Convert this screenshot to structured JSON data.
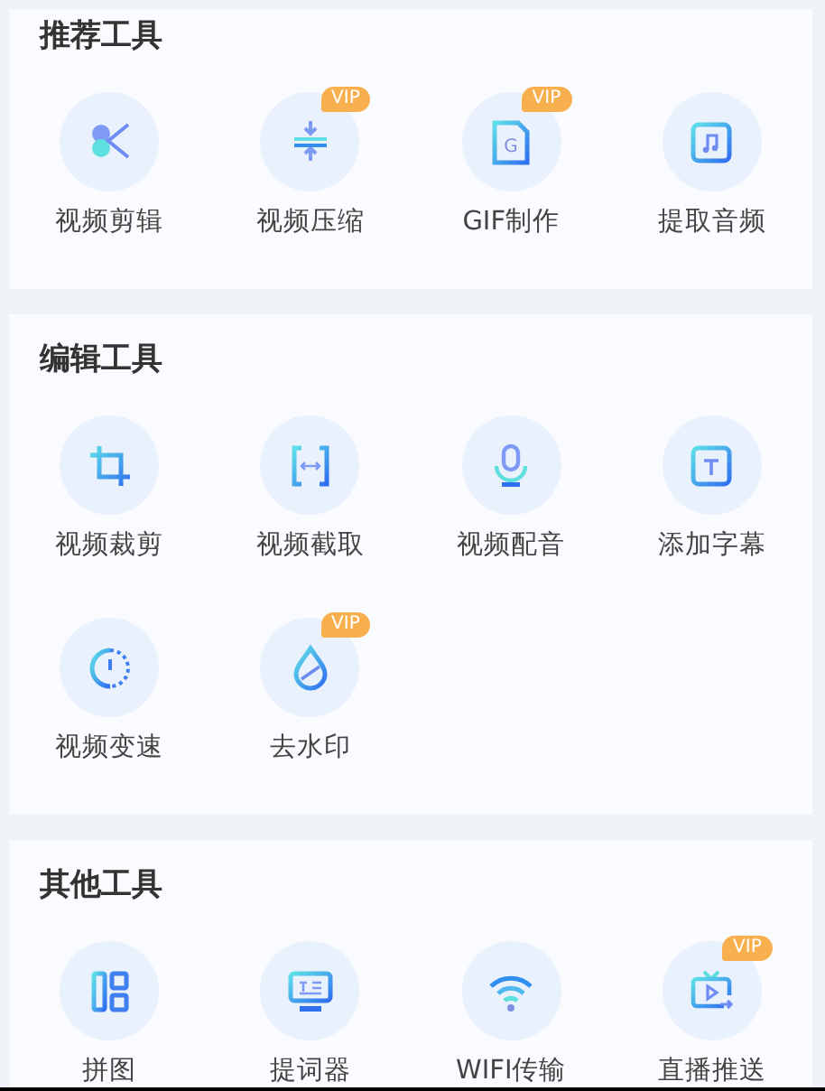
{
  "sections": [
    {
      "title": "推荐工具",
      "tools": [
        {
          "label": "视频剪辑"
        },
        {
          "label": "视频压缩",
          "badge": "VIP"
        },
        {
          "label": "GIF制作",
          "badge": "VIP",
          "glyph": "G"
        },
        {
          "label": "提取音频"
        }
      ]
    },
    {
      "title": "编辑工具",
      "tools": [
        {
          "label": "视频裁剪"
        },
        {
          "label": "视频截取"
        },
        {
          "label": "视频配音"
        },
        {
          "label": "添加字幕"
        },
        {
          "label": "视频变速"
        },
        {
          "label": "去水印",
          "badge": "VIP"
        }
      ]
    },
    {
      "title": "其他工具",
      "tools": [
        {
          "label": "拼图"
        },
        {
          "label": "提词器"
        },
        {
          "label": "WIFI传输"
        },
        {
          "label": "直播推送",
          "badge": "VIP"
        }
      ]
    }
  ]
}
